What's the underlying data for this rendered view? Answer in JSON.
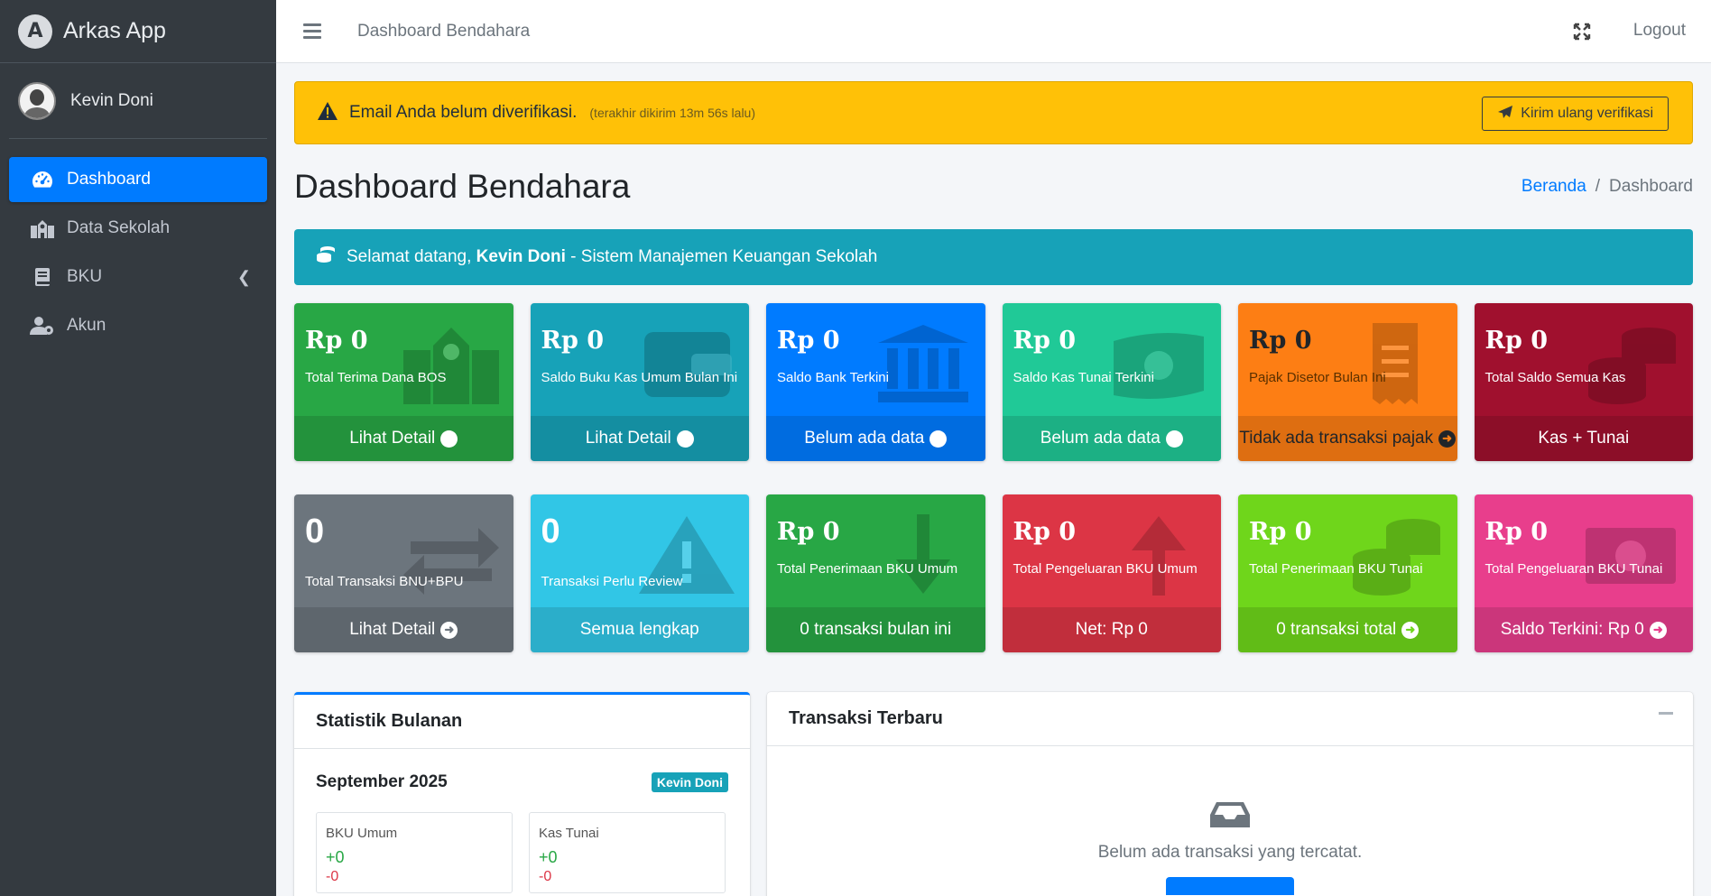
{
  "brand": {
    "name": "Arkas App",
    "logo_letter": "A"
  },
  "user": {
    "name": "Kevin Doni"
  },
  "sidebar": {
    "items": [
      {
        "label": "Dashboard",
        "icon": "tachometer-icon",
        "active": true
      },
      {
        "label": "Data Sekolah",
        "icon": "school-icon"
      },
      {
        "label": "BKU",
        "icon": "book-icon",
        "has_arrow": true
      },
      {
        "label": "Akun",
        "icon": "user-cog-icon"
      }
    ]
  },
  "topbar": {
    "title": "Dashboard Bendahara",
    "logout": "Logout"
  },
  "alert": {
    "text": "Email Anda belum diverifikasi.",
    "sub": "(terakhir dikirim 13m 56s lalu)",
    "button": "Kirim ulang verifikasi"
  },
  "page": {
    "title": "Dashboard Bendahara"
  },
  "breadcrumb": {
    "home": "Beranda",
    "current": "Dashboard"
  },
  "welcome": {
    "prefix": "Selamat datang,",
    "name": "Kevin Doni",
    "suffix": "- Sistem Manajemen Keuangan Sekolah"
  },
  "boxes_row1": [
    {
      "value": "Rp  0",
      "label": "Total Terima Dana BOS",
      "footer": "Lihat Detail",
      "color": "#28a745",
      "arrow": true
    },
    {
      "value": "Rp  0",
      "label": "Saldo Buku Kas Umum Bulan Ini",
      "footer": "Lihat Detail",
      "color": "#17a2b8",
      "arrow": true
    },
    {
      "value": "Rp  0",
      "label": "Saldo Bank Terkini",
      "footer": "Belum ada data",
      "color": "#007bff",
      "arrow": true
    },
    {
      "value": "Rp  0",
      "label": "Saldo Kas Tunai Terkini",
      "footer": "Belum ada data",
      "color": "#20c997",
      "arrow": true
    },
    {
      "value": "Rp  0",
      "label": "Pajak Disetor Bulan Ini",
      "footer": "Tidak ada transaksi pajak",
      "color": "#fd7e14",
      "arrow": true
    },
    {
      "value": "Rp  0",
      "label": "Total Saldo Semua Kas",
      "footer": "Kas + Tunai",
      "color": "#a0102e",
      "arrow": false
    }
  ],
  "boxes_row2": [
    {
      "value": "0",
      "label": "Total Transaksi BNU+BPU",
      "footer": "Lihat Detail",
      "color": "#6c757d",
      "arrow": true
    },
    {
      "value": "0",
      "label": "Transaksi Perlu Review",
      "footer": "Semua lengkap",
      "color": "#31c6e6",
      "arrow": false
    },
    {
      "value": "Rp  0",
      "label": "Total Penerimaan BKU Umum",
      "footer": "0 transaksi bulan ini",
      "color": "#28a745",
      "arrow": false
    },
    {
      "value": "Rp  0",
      "label": "Total Pengeluaran BKU Umum",
      "footer": "Net: Rp 0",
      "color": "#dc3545",
      "arrow": false
    },
    {
      "value": "Rp  0",
      "label": "Total Penerimaan BKU Tunai",
      "footer": "0 transaksi total",
      "color": "#6fd61b",
      "arrow": true
    },
    {
      "value": "Rp  0",
      "label": "Total Pengeluaran BKU Tunai",
      "footer": "Saldo Terkini: Rp 0",
      "color": "#e83e8c",
      "arrow": true
    }
  ],
  "stats": {
    "title": "Statistik Bulanan",
    "month": "September 2025",
    "badge": "Kevin Doni",
    "items": [
      {
        "label": "BKU Umum",
        "plus": "+0",
        "minus": "-0"
      },
      {
        "label": "Kas Tunai",
        "plus": "+0",
        "minus": "-0"
      }
    ]
  },
  "transactions": {
    "title": "Transaksi Terbaru",
    "empty_text": "Belum ada transaksi yang tercatat."
  }
}
